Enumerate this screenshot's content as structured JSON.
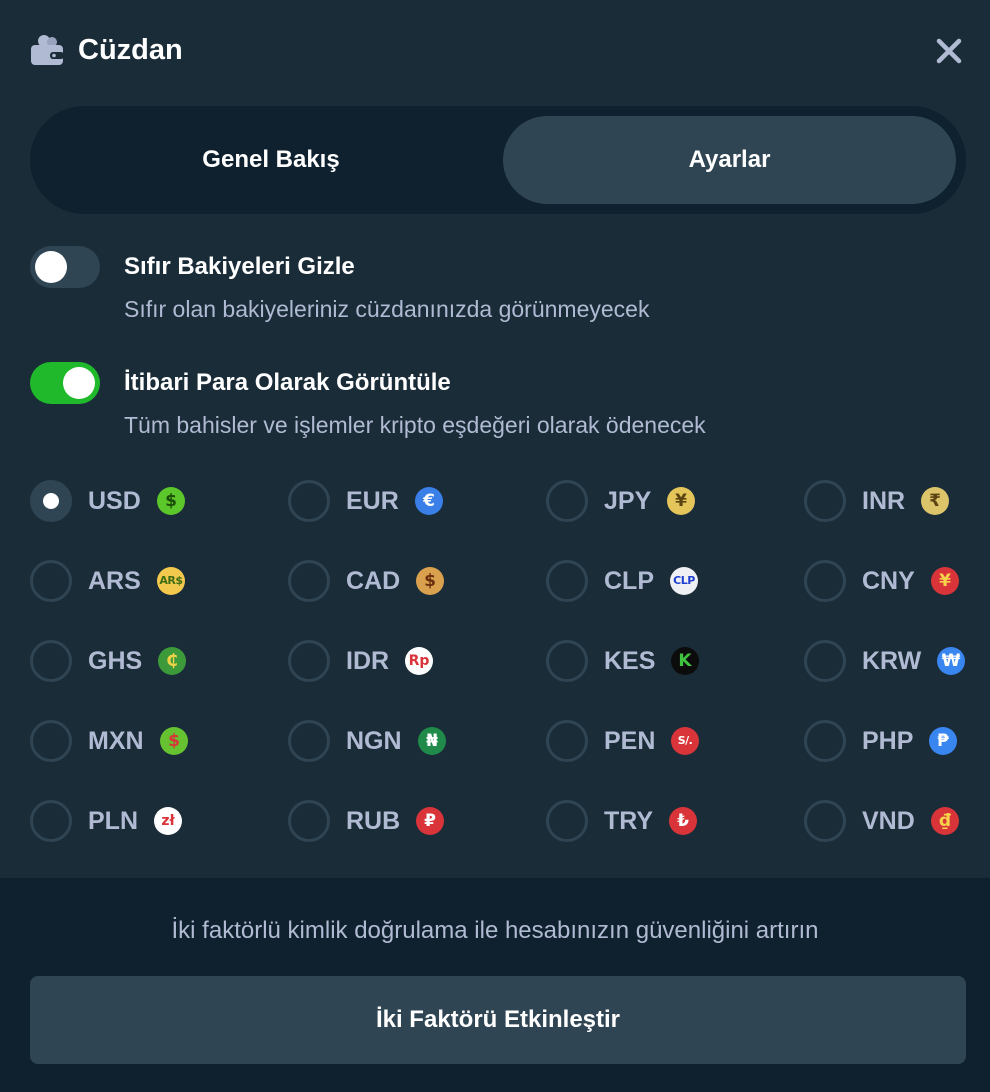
{
  "header": {
    "title": "Cüzdan"
  },
  "tabs": [
    {
      "label": "Genel Bakış",
      "active": false
    },
    {
      "label": "Ayarlar",
      "active": true
    }
  ],
  "settings": {
    "hide_zero": {
      "title": "Sıfır Bakiyeleri Gizle",
      "description": "Sıfır olan bakiyeleriniz cüzdanınızda görünmeyecek",
      "enabled": false
    },
    "display_fiat": {
      "title": "İtibari Para Olarak Görüntüle",
      "description": "Tüm bahisler ve işlemler kripto eşdeğeri olarak ödenecek",
      "enabled": true
    }
  },
  "currencies": [
    {
      "code": "USD",
      "symbol": "$",
      "color": "#5cc72b",
      "symbol_color": "#1a4d08",
      "selected": true
    },
    {
      "code": "EUR",
      "symbol": "€",
      "color": "#3a7ee8",
      "symbol_color": "#ffffff",
      "selected": false
    },
    {
      "code": "JPY",
      "symbol": "¥",
      "color": "#e3c55a",
      "symbol_color": "#5a4310",
      "selected": false
    },
    {
      "code": "INR",
      "symbol": "₹",
      "color": "#dcc46a",
      "symbol_color": "#5a4310",
      "selected": false
    },
    {
      "code": "ARS",
      "symbol": "AR$",
      "color": "#f2c94c",
      "symbol_color": "#3f6b12",
      "selected": false
    },
    {
      "code": "CAD",
      "symbol": "$",
      "color": "#d9a04e",
      "symbol_color": "#6a2f0e",
      "selected": false
    },
    {
      "code": "CLP",
      "symbol": "CLP",
      "color": "#eef0f3",
      "symbol_color": "#1c3fd1",
      "selected": false
    },
    {
      "code": "CNY",
      "symbol": "¥",
      "color": "#d8343a",
      "symbol_color": "#f6d34a",
      "selected": false
    },
    {
      "code": "GHS",
      "symbol": "₵",
      "color": "#3c9a3a",
      "symbol_color": "#f0d247",
      "selected": false
    },
    {
      "code": "IDR",
      "symbol": "Rp",
      "color": "#ffffff",
      "symbol_color": "#d8343a",
      "selected": false
    },
    {
      "code": "KES",
      "symbol": "K",
      "color": "#0c0c0c",
      "symbol_color": "#3fc43f",
      "selected": false
    },
    {
      "code": "KRW",
      "symbol": "₩",
      "color": "#3a86f0",
      "symbol_color": "#ffffff",
      "selected": false
    },
    {
      "code": "MXN",
      "symbol": "$",
      "color": "#66c230",
      "symbol_color": "#d8343a",
      "selected": false
    },
    {
      "code": "NGN",
      "symbol": "₦",
      "color": "#1f8a4a",
      "symbol_color": "#ffffff",
      "selected": false
    },
    {
      "code": "PEN",
      "symbol": "S/.",
      "color": "#d8343a",
      "symbol_color": "#ffffff",
      "selected": false
    },
    {
      "code": "PHP",
      "symbol": "₱",
      "color": "#3a86f0",
      "symbol_color": "#ffffff",
      "selected": false
    },
    {
      "code": "PLN",
      "symbol": "zł",
      "color": "#ffffff",
      "symbol_color": "#d8343a",
      "selected": false
    },
    {
      "code": "RUB",
      "symbol": "₽",
      "color": "#d8343a",
      "symbol_color": "#ffffff",
      "selected": false
    },
    {
      "code": "TRY",
      "symbol": "₺",
      "color": "#d8343a",
      "symbol_color": "#ffffff",
      "selected": false
    },
    {
      "code": "VND",
      "symbol": "₫",
      "color": "#d8343a",
      "symbol_color": "#f6d34a",
      "selected": false
    }
  ],
  "footer": {
    "text": "İki faktörlü kimlik doğrulama ile hesabınızın güvenliğini artırın",
    "button_label": "İki Faktörü Etkinleştir"
  },
  "colors": {
    "background": "#1a2c38",
    "panel_dark": "#0f212e",
    "control": "#2f4553",
    "toggle_on": "#1fb92b",
    "muted_text": "#b1bad3"
  }
}
